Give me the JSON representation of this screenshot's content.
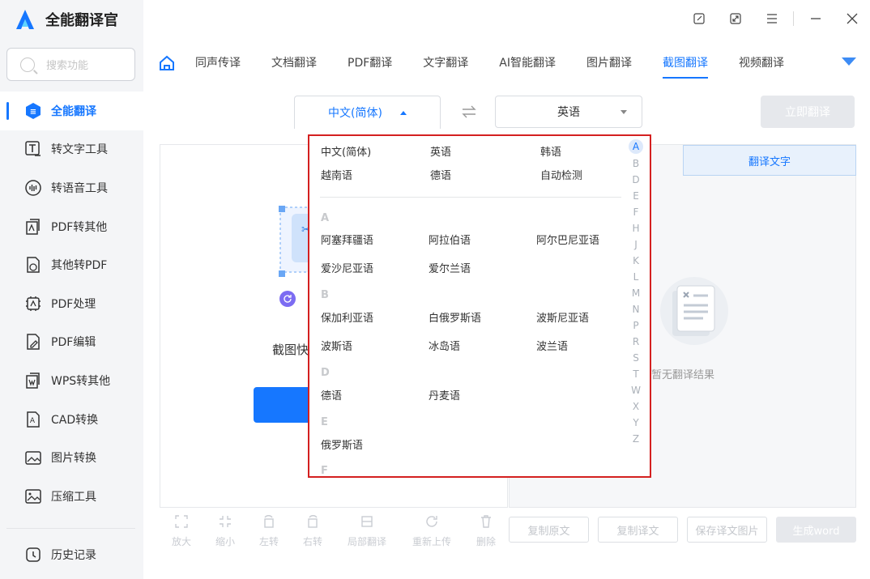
{
  "app": {
    "title": "全能翻译官"
  },
  "sidebar": {
    "search_placeholder": "搜索功能",
    "items": [
      {
        "label": "全能翻译",
        "icon": "translate-icon",
        "active": true
      },
      {
        "label": "转文字工具",
        "icon": "text-tool-icon"
      },
      {
        "label": "转语音工具",
        "icon": "voice-tool-icon"
      },
      {
        "label": "PDF转其他",
        "icon": "pdf-convert-icon"
      },
      {
        "label": "其他转PDF",
        "icon": "to-pdf-icon"
      },
      {
        "label": "PDF处理",
        "icon": "pdf-process-icon"
      },
      {
        "label": "PDF编辑",
        "icon": "pdf-edit-icon"
      },
      {
        "label": "WPS转其他",
        "icon": "wps-convert-icon"
      },
      {
        "label": "CAD转换",
        "icon": "cad-icon"
      },
      {
        "label": "图片转换",
        "icon": "image-convert-icon"
      },
      {
        "label": "压缩工具",
        "icon": "compress-icon"
      }
    ],
    "history_label": "历史记录"
  },
  "tabs": [
    "同声传译",
    "文档翻译",
    "PDF翻译",
    "文字翻译",
    "AI智能翻译",
    "图片翻译",
    "截图翻译",
    "视频翻译"
  ],
  "active_tab": "截图翻译",
  "lang": {
    "source": "中文(简体)",
    "target": "英语",
    "translate_button": "立即翻译"
  },
  "left_panel": {
    "hint": "截图快"
  },
  "right_panel": {
    "tab_label": "翻译文字",
    "empty_text": "暂无翻译结果"
  },
  "toolbar": [
    "放大",
    "缩小",
    "左转",
    "右转",
    "局部翻译",
    "重新上传",
    "删除"
  ],
  "actions": {
    "copy_source": "复制原文",
    "copy_translation": "复制译文",
    "save_image": "保存译文图片",
    "generate_word": "生成word"
  },
  "dropdown": {
    "common": [
      "中文(简体)",
      "英语",
      "韩语",
      "越南语",
      "德语",
      "自动检测"
    ],
    "groups": [
      {
        "letter": "A",
        "langs": [
          "阿塞拜疆语",
          "阿拉伯语",
          "阿尔巴尼亚语",
          "爱沙尼亚语",
          "爱尔兰语"
        ]
      },
      {
        "letter": "B",
        "langs": [
          "保加利亚语",
          "白俄罗斯语",
          "波斯尼亚语",
          "波斯语",
          "冰岛语",
          "波兰语"
        ]
      },
      {
        "letter": "D",
        "langs": [
          "德语",
          "丹麦语"
        ]
      },
      {
        "letter": "E",
        "langs": [
          "俄罗斯语"
        ]
      },
      {
        "letter": "F",
        "langs": []
      }
    ],
    "az_index": [
      "A",
      "B",
      "D",
      "E",
      "F",
      "H",
      "J",
      "K",
      "L",
      "M",
      "N",
      "P",
      "R",
      "S",
      "T",
      "W",
      "X",
      "Y",
      "Z"
    ],
    "az_active": "A"
  },
  "colors": {
    "accent": "#1677ff",
    "dropdown_border": "#d42020"
  }
}
